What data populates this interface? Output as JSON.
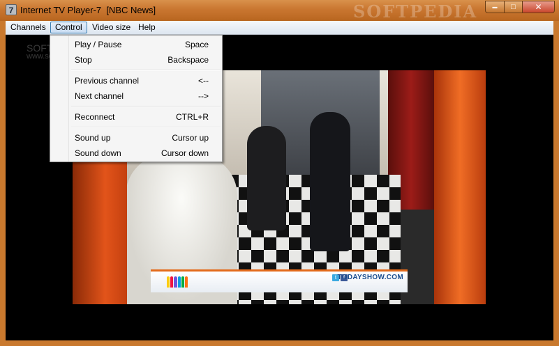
{
  "window": {
    "app_icon_text": "7",
    "title": "Internet TV Player-7  [NBC News]",
    "watermark": "SOFTPEDIA",
    "controls": {
      "minimize_glyph": "▬",
      "maximize_glyph": "□",
      "close_glyph": "✕"
    }
  },
  "menubar": {
    "channels": "Channels",
    "control": "Control",
    "video_size": "Video size",
    "help": "Help"
  },
  "overlay": {
    "softpedia_line1": "SOFTPEDIA",
    "softpedia_line2": "www.softpedia.com"
  },
  "control_menu": {
    "items": [
      {
        "label": "Play / Pause",
        "shortcut": "Space"
      },
      {
        "label": "Stop",
        "shortcut": "Backspace"
      },
      {
        "label": "Previous channel",
        "shortcut": "<--"
      },
      {
        "label": "Next channel",
        "shortcut": "-->"
      },
      {
        "label": "Reconnect",
        "shortcut": "CTRL+R"
      },
      {
        "label": "Sound up",
        "shortcut": "Cursor up"
      },
      {
        "label": "Sound down",
        "shortcut": "Cursor down"
      }
    ]
  },
  "video": {
    "lower_third_text": "TODAYSHOW.COM",
    "icon_twitter": "t",
    "icon_facebook": "f",
    "peacock_colors": [
      "#fccc12",
      "#ef1541",
      "#6e55dc",
      "#069de0",
      "#05ac3f",
      "#ff7112"
    ]
  },
  "colors": {
    "titlebar": "#c97630",
    "menu_highlight_border": "#3c7fb1"
  }
}
